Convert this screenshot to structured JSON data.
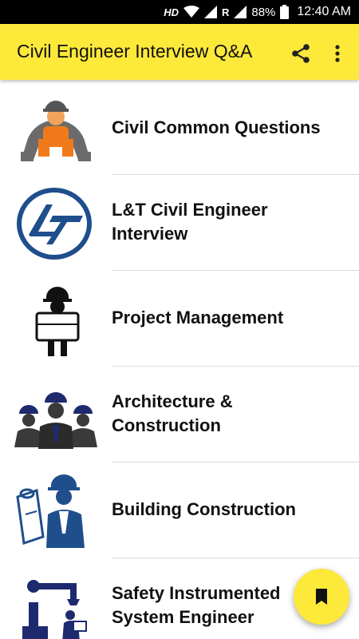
{
  "status_bar": {
    "network_hd": "HD",
    "roaming": "R",
    "battery": "88%",
    "time": "12:40 AM"
  },
  "app_bar": {
    "title": "Civil Engineer Interview Q&A",
    "share_icon": "share-icon",
    "menu_icon": "more-vert-icon",
    "color": "#fde93a"
  },
  "items": [
    {
      "line1": "Civil Common Questions",
      "line2": "",
      "icon": "worker-gear-icon"
    },
    {
      "line1": "L&T Civil Engineer",
      "line2": "Interview",
      "icon": "lt-logo-icon"
    },
    {
      "line1": "Project Management",
      "line2": "",
      "icon": "engineer-blueprint-icon"
    },
    {
      "line1": "Architecture &",
      "line2": "Construction",
      "icon": "engineer-team-icon"
    },
    {
      "line1": "Building Construction",
      "line2": "",
      "icon": "engineer-plans-icon"
    },
    {
      "line1": "Safety Instrumented",
      "line2": "System Engineer",
      "icon": "robot-arm-worker-icon"
    }
  ],
  "fab": {
    "icon": "bookmark-icon",
    "color": "#fde93a"
  }
}
